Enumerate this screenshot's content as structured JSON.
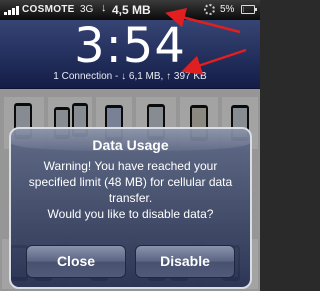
{
  "status_bar": {
    "carrier": "COSMOTE",
    "network": "3G",
    "download_arrow": "↓",
    "download_value": "4,5 MB",
    "battery_percent": "5%",
    "battery_level": 0.05
  },
  "lock_screen": {
    "time": "3:54",
    "connection_info": "1 Connection - ↓ 6,1 MB, ↑ 397 KB"
  },
  "alert": {
    "title": "Data Usage",
    "message_line1": "Warning! You have reached your specified limit (48 MB) for cellular data transfer.",
    "message_line2": "Would you like to disable data?",
    "close_label": "Close",
    "disable_label": "Disable"
  },
  "colors": {
    "annotation_arrow": "#e02020",
    "alert_border": "#d9dde6",
    "clock_panel": "#1e2a66"
  },
  "icons": [
    "signal-bars-icon",
    "activity-spinner-icon",
    "battery-icon",
    "annotation-arrow-icon"
  ]
}
